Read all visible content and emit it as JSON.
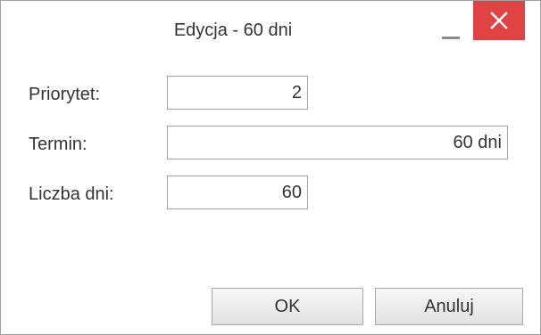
{
  "window": {
    "title": "Edycja - 60 dni",
    "close_icon": "close-icon",
    "minimize_icon": "minimize-icon",
    "close_color": "#e04343"
  },
  "form": {
    "priority": {
      "label": "Priorytet:",
      "value": "2"
    },
    "deadline": {
      "label": "Termin:",
      "value": "60 dni"
    },
    "days": {
      "label": "Liczba dni:",
      "value": "60"
    }
  },
  "buttons": {
    "ok_label": "OK",
    "cancel_label": "Anuluj"
  }
}
